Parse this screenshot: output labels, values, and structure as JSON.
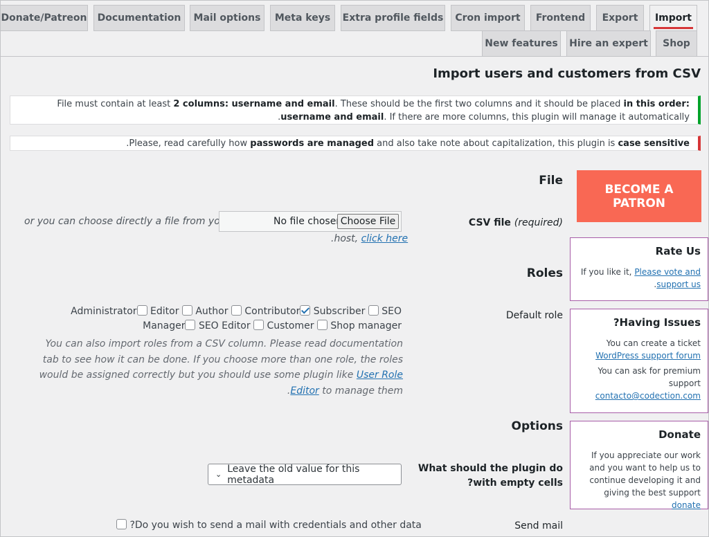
{
  "tabs": {
    "row1": [
      "Donate/Patreon",
      "Documentation",
      "Mail options",
      "Meta keys",
      "Extra profile fields",
      "Cron import",
      "Frontend",
      "Export",
      "Import"
    ],
    "row2": [
      "New features",
      "Hire an expert",
      "Shop"
    ],
    "active": "Import"
  },
  "page_title": "Import users and customers from CSV",
  "notice1": {
    "part1": "File must contain at least ",
    "bold1": "2 columns: username and email",
    "part2": ". These should be the first two columns and it should be placed ",
    "bold2": "in this order: username and email",
    "part3": ". If there are more columns, this plugin will manage it automatically."
  },
  "notice2": {
    "part1": "Please, read carefully how ",
    "bold1": "passwords are managed",
    "part2": " and also take note about capitalization, this plugin is ",
    "bold2": "case sensitive",
    "part3": "."
  },
  "file_section": {
    "heading": "File",
    "csv_label": "CSV file",
    "required": "(required)",
    "no_file": "No file chosen",
    "choose_file": "Choose File",
    "alt_text_1": "or you can choose directly a file from your",
    "alt_text_2": "host, ",
    "click_here": "click here",
    "alt_text_end": "."
  },
  "roles_section": {
    "heading": "Roles",
    "default_role_label": "Default role",
    "roles": [
      {
        "label": "Administrator",
        "checked": false
      },
      {
        "label": "Editor",
        "checked": false
      },
      {
        "label": "Author",
        "checked": false
      },
      {
        "label": "Contributor",
        "checked": false
      },
      {
        "label": "Subscriber",
        "checked": true
      },
      {
        "label": "SEO Manager",
        "checked": false
      },
      {
        "label": "SEO Editor",
        "checked": false
      },
      {
        "label": "Customer",
        "checked": false
      },
      {
        "label": "Shop manager",
        "checked": false
      }
    ],
    "help_1": "You can also import roles from a CSV column. Please read documentation tab to see how it can be done. If you choose more than one role, the roles would be assigned correctly but you should use some plugin like ",
    "help_link": "User Role Editor",
    "help_2": " to manage them."
  },
  "options_section": {
    "heading": "Options",
    "empty_cells_label": "What should the plugin do with empty cells?",
    "empty_cells_value": "Leave the old value for this metadata",
    "send_mail_label": "Send mail",
    "send_mail_text": "Do you wish to send a mail with credentials and other data?"
  },
  "sidebar": {
    "patron_line1": "BECOME A",
    "patron_line2": "PATRON",
    "rate": {
      "title": "Rate Us",
      "text": "If you like it, ",
      "link": "Please vote and support us",
      "end": "."
    },
    "issues": {
      "title": "Having Issues?",
      "text1": "You can create a ticket",
      "link1": "WordPress support forum",
      "text2": "You can ask for premium support",
      "link2": "contacto@codection.com"
    },
    "donate": {
      "title": "Donate",
      "text": "If you appreciate our work and you want to help us to continue developing it and giving the best support ",
      "link": "donate"
    }
  }
}
